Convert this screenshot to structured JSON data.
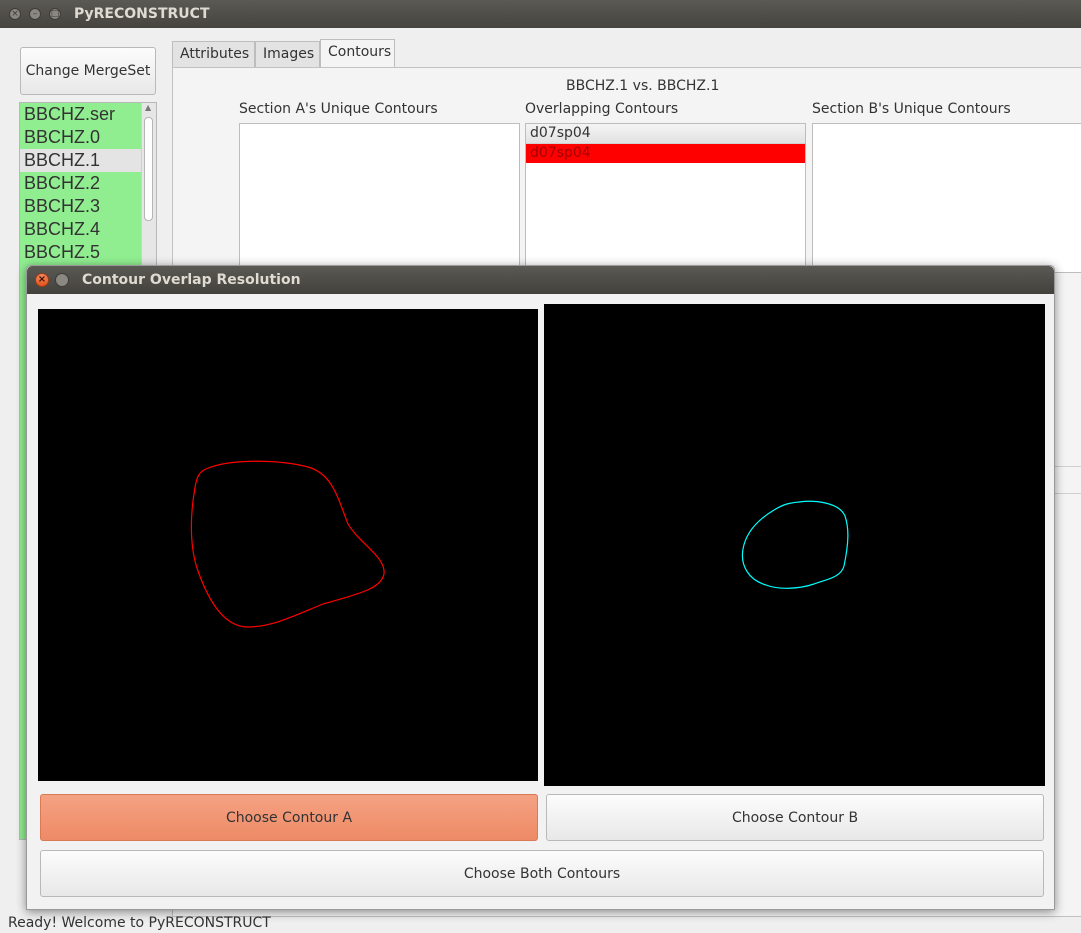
{
  "main_window": {
    "title": "PyRECONSTRUCT",
    "merge_button": "Change MergeSet",
    "sections": [
      "BBCHZ.ser",
      "BBCHZ.0",
      "BBCHZ.1",
      "BBCHZ.2",
      "BBCHZ.3",
      "BBCHZ.4",
      "BBCHZ.5"
    ],
    "selected_section": "BBCHZ.1",
    "tabs": [
      "Attributes",
      "Images",
      "Contours"
    ],
    "active_tab": "Contours",
    "comparison_title": "BBCHZ.1 vs. BBCHZ.1",
    "column_a_label": "Section A's Unique Contours",
    "column_overlap_label": "Overlapping Contours",
    "column_b_label": "Section B's Unique Contours",
    "overlapping_items": [
      "d07sp04",
      "d07sp04"
    ],
    "status": "Ready! Welcome to PyRECONSTRUCT"
  },
  "dialog": {
    "title": "Contour Overlap Resolution",
    "choose_a": "Choose Contour A",
    "choose_b": "Choose Contour B",
    "choose_both": "Choose Both Contours",
    "contour_a_color": "#ff0000",
    "contour_b_color": "#00ffff",
    "highlight_color": "#ff0000",
    "section_list_color": "#90ee90"
  }
}
